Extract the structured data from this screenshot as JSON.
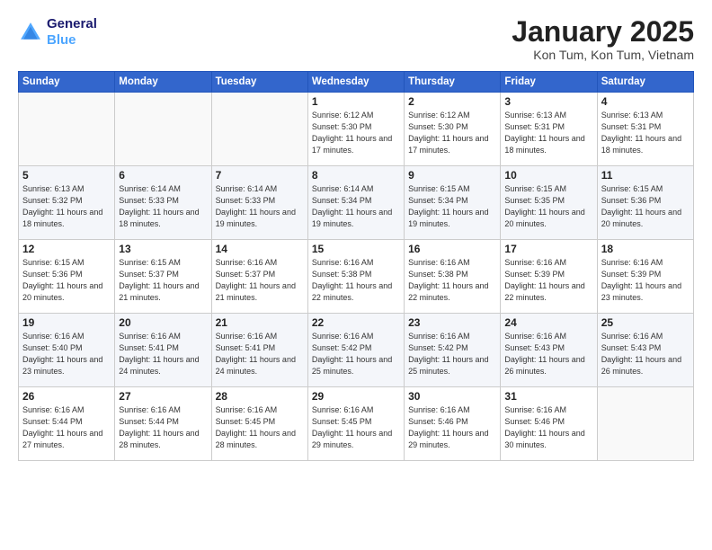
{
  "header": {
    "logo_line1": "General",
    "logo_line2": "Blue",
    "month_title": "January 2025",
    "location": "Kon Tum, Kon Tum, Vietnam"
  },
  "days_of_week": [
    "Sunday",
    "Monday",
    "Tuesday",
    "Wednesday",
    "Thursday",
    "Friday",
    "Saturday"
  ],
  "weeks": [
    [
      {
        "day": "",
        "sunrise": "",
        "sunset": "",
        "daylight": ""
      },
      {
        "day": "",
        "sunrise": "",
        "sunset": "",
        "daylight": ""
      },
      {
        "day": "",
        "sunrise": "",
        "sunset": "",
        "daylight": ""
      },
      {
        "day": "1",
        "sunrise": "Sunrise: 6:12 AM",
        "sunset": "Sunset: 5:30 PM",
        "daylight": "Daylight: 11 hours and 17 minutes."
      },
      {
        "day": "2",
        "sunrise": "Sunrise: 6:12 AM",
        "sunset": "Sunset: 5:30 PM",
        "daylight": "Daylight: 11 hours and 17 minutes."
      },
      {
        "day": "3",
        "sunrise": "Sunrise: 6:13 AM",
        "sunset": "Sunset: 5:31 PM",
        "daylight": "Daylight: 11 hours and 18 minutes."
      },
      {
        "day": "4",
        "sunrise": "Sunrise: 6:13 AM",
        "sunset": "Sunset: 5:31 PM",
        "daylight": "Daylight: 11 hours and 18 minutes."
      }
    ],
    [
      {
        "day": "5",
        "sunrise": "Sunrise: 6:13 AM",
        "sunset": "Sunset: 5:32 PM",
        "daylight": "Daylight: 11 hours and 18 minutes."
      },
      {
        "day": "6",
        "sunrise": "Sunrise: 6:14 AM",
        "sunset": "Sunset: 5:33 PM",
        "daylight": "Daylight: 11 hours and 18 minutes."
      },
      {
        "day": "7",
        "sunrise": "Sunrise: 6:14 AM",
        "sunset": "Sunset: 5:33 PM",
        "daylight": "Daylight: 11 hours and 19 minutes."
      },
      {
        "day": "8",
        "sunrise": "Sunrise: 6:14 AM",
        "sunset": "Sunset: 5:34 PM",
        "daylight": "Daylight: 11 hours and 19 minutes."
      },
      {
        "day": "9",
        "sunrise": "Sunrise: 6:15 AM",
        "sunset": "Sunset: 5:34 PM",
        "daylight": "Daylight: 11 hours and 19 minutes."
      },
      {
        "day": "10",
        "sunrise": "Sunrise: 6:15 AM",
        "sunset": "Sunset: 5:35 PM",
        "daylight": "Daylight: 11 hours and 20 minutes."
      },
      {
        "day": "11",
        "sunrise": "Sunrise: 6:15 AM",
        "sunset": "Sunset: 5:36 PM",
        "daylight": "Daylight: 11 hours and 20 minutes."
      }
    ],
    [
      {
        "day": "12",
        "sunrise": "Sunrise: 6:15 AM",
        "sunset": "Sunset: 5:36 PM",
        "daylight": "Daylight: 11 hours and 20 minutes."
      },
      {
        "day": "13",
        "sunrise": "Sunrise: 6:15 AM",
        "sunset": "Sunset: 5:37 PM",
        "daylight": "Daylight: 11 hours and 21 minutes."
      },
      {
        "day": "14",
        "sunrise": "Sunrise: 6:16 AM",
        "sunset": "Sunset: 5:37 PM",
        "daylight": "Daylight: 11 hours and 21 minutes."
      },
      {
        "day": "15",
        "sunrise": "Sunrise: 6:16 AM",
        "sunset": "Sunset: 5:38 PM",
        "daylight": "Daylight: 11 hours and 22 minutes."
      },
      {
        "day": "16",
        "sunrise": "Sunrise: 6:16 AM",
        "sunset": "Sunset: 5:38 PM",
        "daylight": "Daylight: 11 hours and 22 minutes."
      },
      {
        "day": "17",
        "sunrise": "Sunrise: 6:16 AM",
        "sunset": "Sunset: 5:39 PM",
        "daylight": "Daylight: 11 hours and 22 minutes."
      },
      {
        "day": "18",
        "sunrise": "Sunrise: 6:16 AM",
        "sunset": "Sunset: 5:39 PM",
        "daylight": "Daylight: 11 hours and 23 minutes."
      }
    ],
    [
      {
        "day": "19",
        "sunrise": "Sunrise: 6:16 AM",
        "sunset": "Sunset: 5:40 PM",
        "daylight": "Daylight: 11 hours and 23 minutes."
      },
      {
        "day": "20",
        "sunrise": "Sunrise: 6:16 AM",
        "sunset": "Sunset: 5:41 PM",
        "daylight": "Daylight: 11 hours and 24 minutes."
      },
      {
        "day": "21",
        "sunrise": "Sunrise: 6:16 AM",
        "sunset": "Sunset: 5:41 PM",
        "daylight": "Daylight: 11 hours and 24 minutes."
      },
      {
        "day": "22",
        "sunrise": "Sunrise: 6:16 AM",
        "sunset": "Sunset: 5:42 PM",
        "daylight": "Daylight: 11 hours and 25 minutes."
      },
      {
        "day": "23",
        "sunrise": "Sunrise: 6:16 AM",
        "sunset": "Sunset: 5:42 PM",
        "daylight": "Daylight: 11 hours and 25 minutes."
      },
      {
        "day": "24",
        "sunrise": "Sunrise: 6:16 AM",
        "sunset": "Sunset: 5:43 PM",
        "daylight": "Daylight: 11 hours and 26 minutes."
      },
      {
        "day": "25",
        "sunrise": "Sunrise: 6:16 AM",
        "sunset": "Sunset: 5:43 PM",
        "daylight": "Daylight: 11 hours and 26 minutes."
      }
    ],
    [
      {
        "day": "26",
        "sunrise": "Sunrise: 6:16 AM",
        "sunset": "Sunset: 5:44 PM",
        "daylight": "Daylight: 11 hours and 27 minutes."
      },
      {
        "day": "27",
        "sunrise": "Sunrise: 6:16 AM",
        "sunset": "Sunset: 5:44 PM",
        "daylight": "Daylight: 11 hours and 28 minutes."
      },
      {
        "day": "28",
        "sunrise": "Sunrise: 6:16 AM",
        "sunset": "Sunset: 5:45 PM",
        "daylight": "Daylight: 11 hours and 28 minutes."
      },
      {
        "day": "29",
        "sunrise": "Sunrise: 6:16 AM",
        "sunset": "Sunset: 5:45 PM",
        "daylight": "Daylight: 11 hours and 29 minutes."
      },
      {
        "day": "30",
        "sunrise": "Sunrise: 6:16 AM",
        "sunset": "Sunset: 5:46 PM",
        "daylight": "Daylight: 11 hours and 29 minutes."
      },
      {
        "day": "31",
        "sunrise": "Sunrise: 6:16 AM",
        "sunset": "Sunset: 5:46 PM",
        "daylight": "Daylight: 11 hours and 30 minutes."
      },
      {
        "day": "",
        "sunrise": "",
        "sunset": "",
        "daylight": ""
      }
    ]
  ]
}
